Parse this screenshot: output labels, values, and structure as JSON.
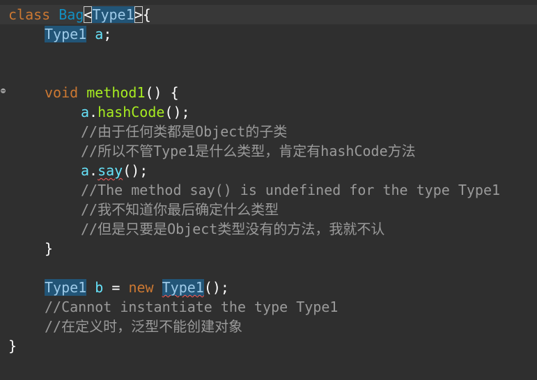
{
  "editor": {
    "lines": [
      {
        "id": "l1",
        "tokens": [
          "class",
          "Bag",
          "<",
          "Type1",
          ">",
          "{"
        ]
      },
      {
        "id": "l2",
        "tokens": [
          "Type1",
          "a",
          ";"
        ]
      },
      {
        "id": "l5",
        "tokens": [
          "void",
          "method1",
          "() {"
        ]
      },
      {
        "id": "l6",
        "tokens": [
          "a",
          ".",
          "hashCode",
          "();"
        ]
      },
      {
        "id": "l7",
        "tokens": [
          "//由于任何类都是Object的子类"
        ]
      },
      {
        "id": "l8",
        "tokens": [
          "//所以不管Type1是什么类型，肯定有hashCode方法"
        ]
      },
      {
        "id": "l9",
        "tokens": [
          "a",
          ".",
          "say",
          "();"
        ]
      },
      {
        "id": "l10",
        "tokens": [
          "//The method say() is undefined for the type Type1"
        ]
      },
      {
        "id": "l11",
        "tokens": [
          "//我不知道你最后确定什么类型"
        ]
      },
      {
        "id": "l12",
        "tokens": [
          "//但是只要是Object类型没有的方法，我就不认"
        ]
      },
      {
        "id": "l13",
        "tokens": [
          "}"
        ]
      },
      {
        "id": "l15",
        "tokens": [
          "Type1",
          "b",
          "=",
          "new",
          "Type1",
          "();"
        ]
      },
      {
        "id": "l16",
        "tokens": [
          "//Cannot instantiate the type Type1"
        ]
      },
      {
        "id": "l17",
        "tokens": [
          "//在定义时，泛型不能创建对象"
        ]
      },
      {
        "id": "l18",
        "tokens": [
          "}"
        ]
      }
    ]
  },
  "gutter": {
    "fold_icon": "fold-collapse-icon"
  },
  "colors": {
    "background": "#2f2f2f",
    "current_line": "#383838",
    "keyword": "#cc7832",
    "class_name": "#1290c3",
    "type_param": "#9ecae8",
    "type_highlight_bg": "#225577",
    "field": "#66e1f8",
    "method": "#a7ec21",
    "comment": "#9a9a9a",
    "error_squiggle": "#ff5f5f"
  }
}
